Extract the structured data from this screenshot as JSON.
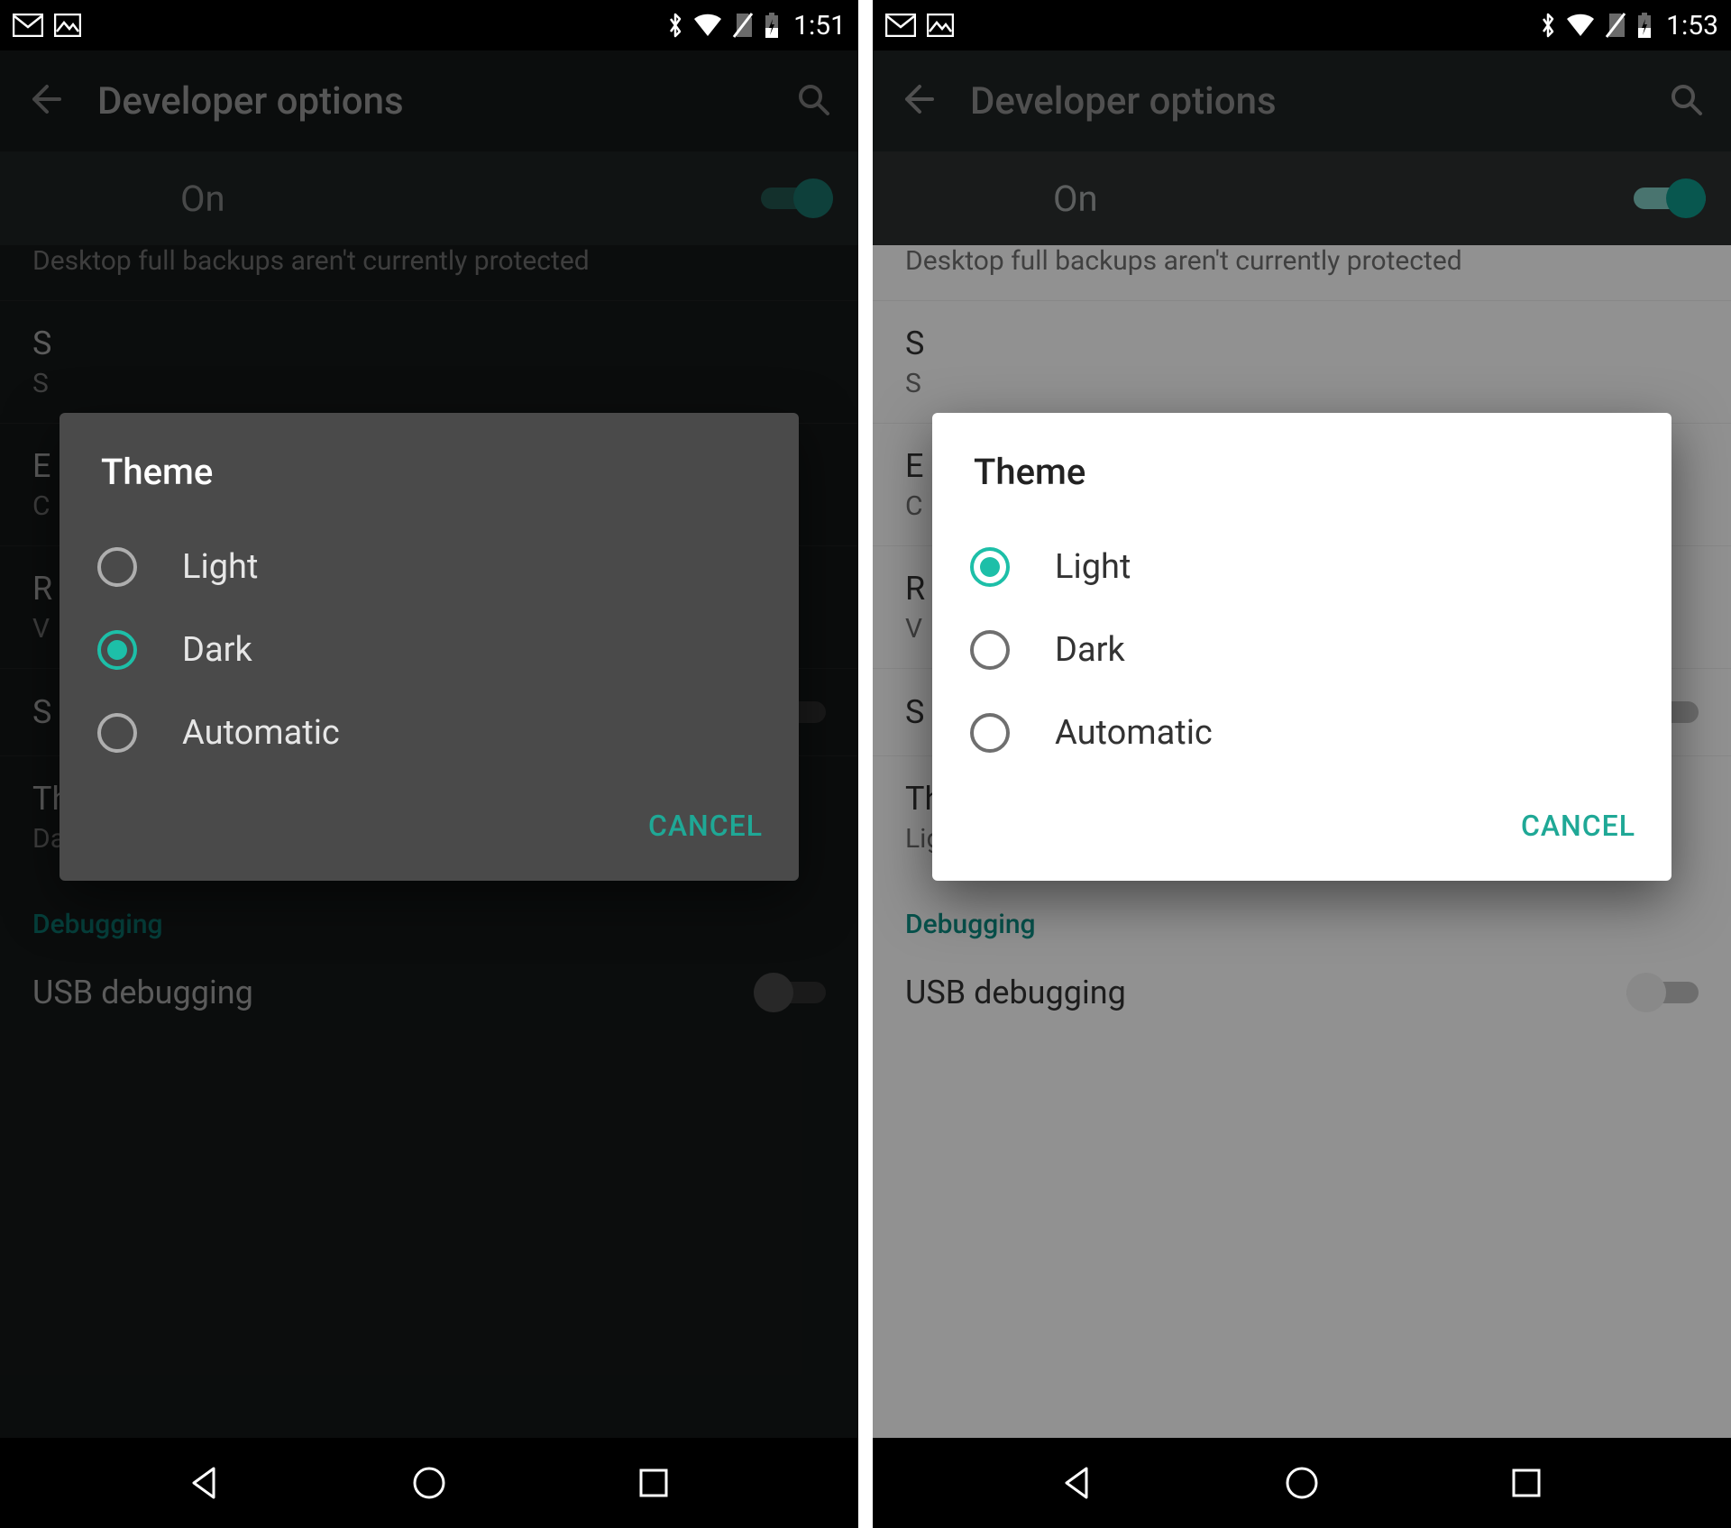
{
  "accent": "#1fa896",
  "screens": {
    "left": {
      "theme": "dark",
      "status": {
        "time": "1:51"
      },
      "appbar_title": "Developer options",
      "toggle_label": "On",
      "cut_row_text": "Desktop full backups aren't currently protected",
      "rows": {
        "s_primary": "S",
        "s_secondary": "S",
        "e_primary": "E",
        "e_secondary": "C",
        "r_primary": "R",
        "r_secondary": "V",
        "s2_primary": "S",
        "theme_primary": "Theme",
        "theme_secondary": "Dark",
        "section_debug": "Debugging",
        "usb_primary": "USB debugging"
      },
      "dialog": {
        "title": "Theme",
        "options": {
          "o0": "Light",
          "o1": "Dark",
          "o2": "Automatic"
        },
        "selected_index": 1,
        "cancel": "CANCEL"
      }
    },
    "right": {
      "theme": "light",
      "status": {
        "time": "1:53"
      },
      "appbar_title": "Developer options",
      "toggle_label": "On",
      "cut_row_text": "Desktop full backups aren't currently protected",
      "rows": {
        "s_primary": "S",
        "s_secondary": "S",
        "e_primary": "E",
        "e_secondary": "C",
        "r_primary": "R",
        "r_secondary": "V",
        "s2_primary": "S",
        "theme_primary": "Theme",
        "theme_secondary": "Light",
        "section_debug": "Debugging",
        "usb_primary": "USB debugging"
      },
      "dialog": {
        "title": "Theme",
        "options": {
          "o0": "Light",
          "o1": "Dark",
          "o2": "Automatic"
        },
        "selected_index": 0,
        "cancel": "CANCEL"
      }
    }
  }
}
